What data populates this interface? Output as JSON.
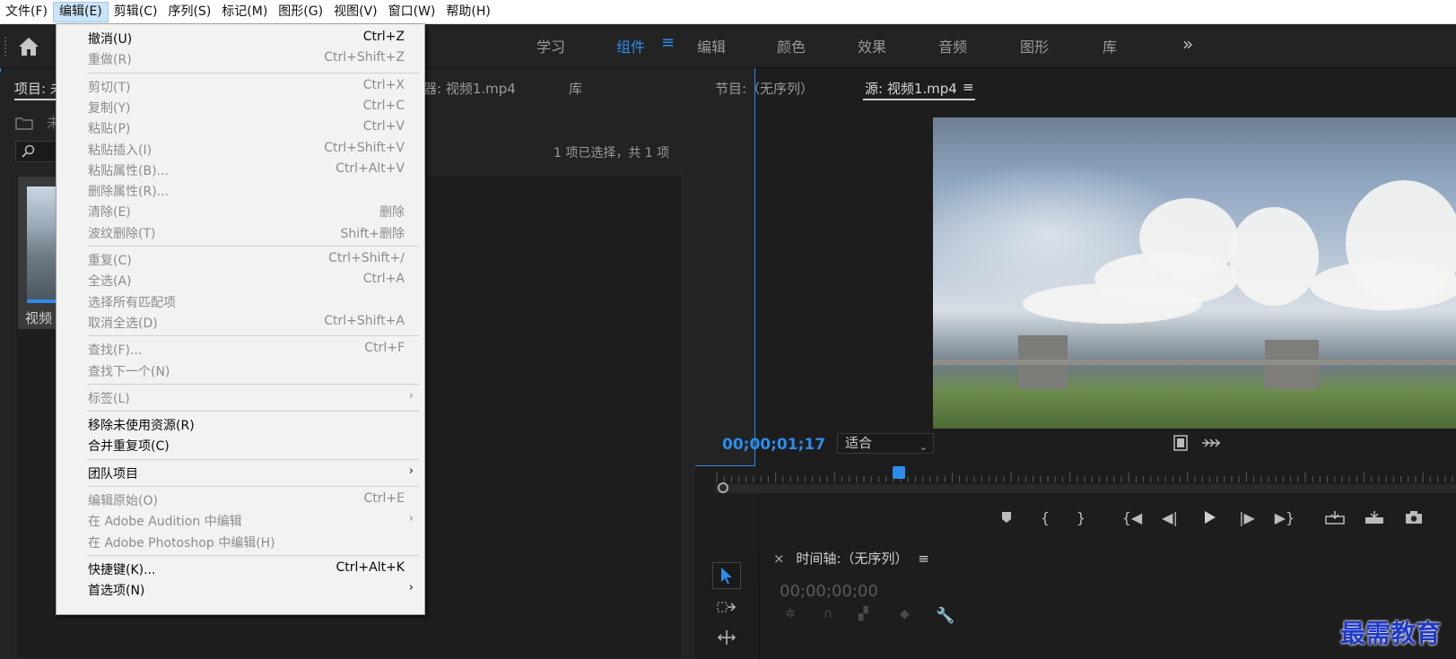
{
  "menubar": {
    "items": [
      {
        "label": "文件(F)",
        "active": false
      },
      {
        "label": "编辑(E)",
        "active": true
      },
      {
        "label": "剪辑(C)",
        "active": false
      },
      {
        "label": "序列(S)",
        "active": false
      },
      {
        "label": "标记(M)",
        "active": false
      },
      {
        "label": "图形(G)",
        "active": false
      },
      {
        "label": "视图(V)",
        "active": false
      },
      {
        "label": "窗口(W)",
        "active": false
      },
      {
        "label": "帮助(H)",
        "active": false
      }
    ]
  },
  "workspace": {
    "tabs": [
      {
        "label": "学习",
        "active": false
      },
      {
        "label": "组件",
        "active": true
      },
      {
        "label": "编辑",
        "active": false
      },
      {
        "label": "颜色",
        "active": false
      },
      {
        "label": "效果",
        "active": false
      },
      {
        "label": "音频",
        "active": false
      },
      {
        "label": "图形",
        "active": false
      },
      {
        "label": "库",
        "active": false
      }
    ],
    "menu_glyph": "≡",
    "more_glyph": "»"
  },
  "project": {
    "tab_label_partial": "项目: 未",
    "tab2_partial": "器: 视频1.mp4",
    "tab3": "库",
    "folder_label_partial": "未",
    "selection_count": "1 项已选择，共 1 项",
    "thumb_label_partial": "视频"
  },
  "source": {
    "program_tab": "节目:（无序列）",
    "source_tab": "源: 视频1.mp4",
    "menu_glyph": "≡",
    "timecode": "00;00;01;17",
    "fit_option": "适合",
    "playhead_fraction": 0.24
  },
  "timeline": {
    "close_glyph": "×",
    "title": "时间轴:（无序列）",
    "menu_glyph": "≡",
    "timecode": "00;00;00;00"
  },
  "watermark": "最需教育",
  "edit_menu": {
    "items": [
      {
        "label": "撤消(U)",
        "shortcut": "Ctrl+Z",
        "enabled": true,
        "submenu": false
      },
      {
        "label": "重做(R)",
        "shortcut": "Ctrl+Shift+Z",
        "enabled": false,
        "submenu": false
      },
      {
        "separator": true
      },
      {
        "label": "剪切(T)",
        "shortcut": "Ctrl+X",
        "enabled": false,
        "submenu": false
      },
      {
        "label": "复制(Y)",
        "shortcut": "Ctrl+C",
        "enabled": false,
        "submenu": false
      },
      {
        "label": "粘贴(P)",
        "shortcut": "Ctrl+V",
        "enabled": false,
        "submenu": false
      },
      {
        "label": "粘贴插入(I)",
        "shortcut": "Ctrl+Shift+V",
        "enabled": false,
        "submenu": false
      },
      {
        "label": "粘贴属性(B)...",
        "shortcut": "Ctrl+Alt+V",
        "enabled": false,
        "submenu": false
      },
      {
        "label": "删除属性(R)...",
        "shortcut": "",
        "enabled": false,
        "submenu": false
      },
      {
        "label": "清除(E)",
        "shortcut": "删除",
        "enabled": false,
        "submenu": false
      },
      {
        "label": "波纹删除(T)",
        "shortcut": "Shift+删除",
        "enabled": false,
        "submenu": false
      },
      {
        "separator": true
      },
      {
        "label": "重复(C)",
        "shortcut": "Ctrl+Shift+/",
        "enabled": false,
        "submenu": false
      },
      {
        "label": "全选(A)",
        "shortcut": "Ctrl+A",
        "enabled": false,
        "submenu": false
      },
      {
        "label": "选择所有匹配项",
        "shortcut": "",
        "enabled": false,
        "submenu": false
      },
      {
        "label": "取消全选(D)",
        "shortcut": "Ctrl+Shift+A",
        "enabled": false,
        "submenu": false
      },
      {
        "separator": true
      },
      {
        "label": "查找(F)...",
        "shortcut": "Ctrl+F",
        "enabled": false,
        "submenu": false
      },
      {
        "label": "查找下一个(N)",
        "shortcut": "",
        "enabled": false,
        "submenu": false
      },
      {
        "separator": true
      },
      {
        "label": "标签(L)",
        "shortcut": "",
        "enabled": false,
        "submenu": true
      },
      {
        "separator": true
      },
      {
        "label": "移除未使用资源(R)",
        "shortcut": "",
        "enabled": true,
        "submenu": false
      },
      {
        "label": "合并重复项(C)",
        "shortcut": "",
        "enabled": true,
        "submenu": false
      },
      {
        "separator": true
      },
      {
        "label": "团队项目",
        "shortcut": "",
        "enabled": true,
        "submenu": true
      },
      {
        "separator": true
      },
      {
        "label": "编辑原始(O)",
        "shortcut": "Ctrl+E",
        "enabled": false,
        "submenu": false
      },
      {
        "label": "在 Adobe Audition 中编辑",
        "shortcut": "",
        "enabled": false,
        "submenu": true
      },
      {
        "label": "在 Adobe Photoshop 中编辑(H)",
        "shortcut": "",
        "enabled": false,
        "submenu": false
      },
      {
        "separator": true
      },
      {
        "label": "快捷键(K)...",
        "shortcut": "Ctrl+Alt+K",
        "enabled": true,
        "submenu": false
      },
      {
        "label": "首选项(N)",
        "shortcut": "",
        "enabled": true,
        "submenu": true
      }
    ]
  }
}
